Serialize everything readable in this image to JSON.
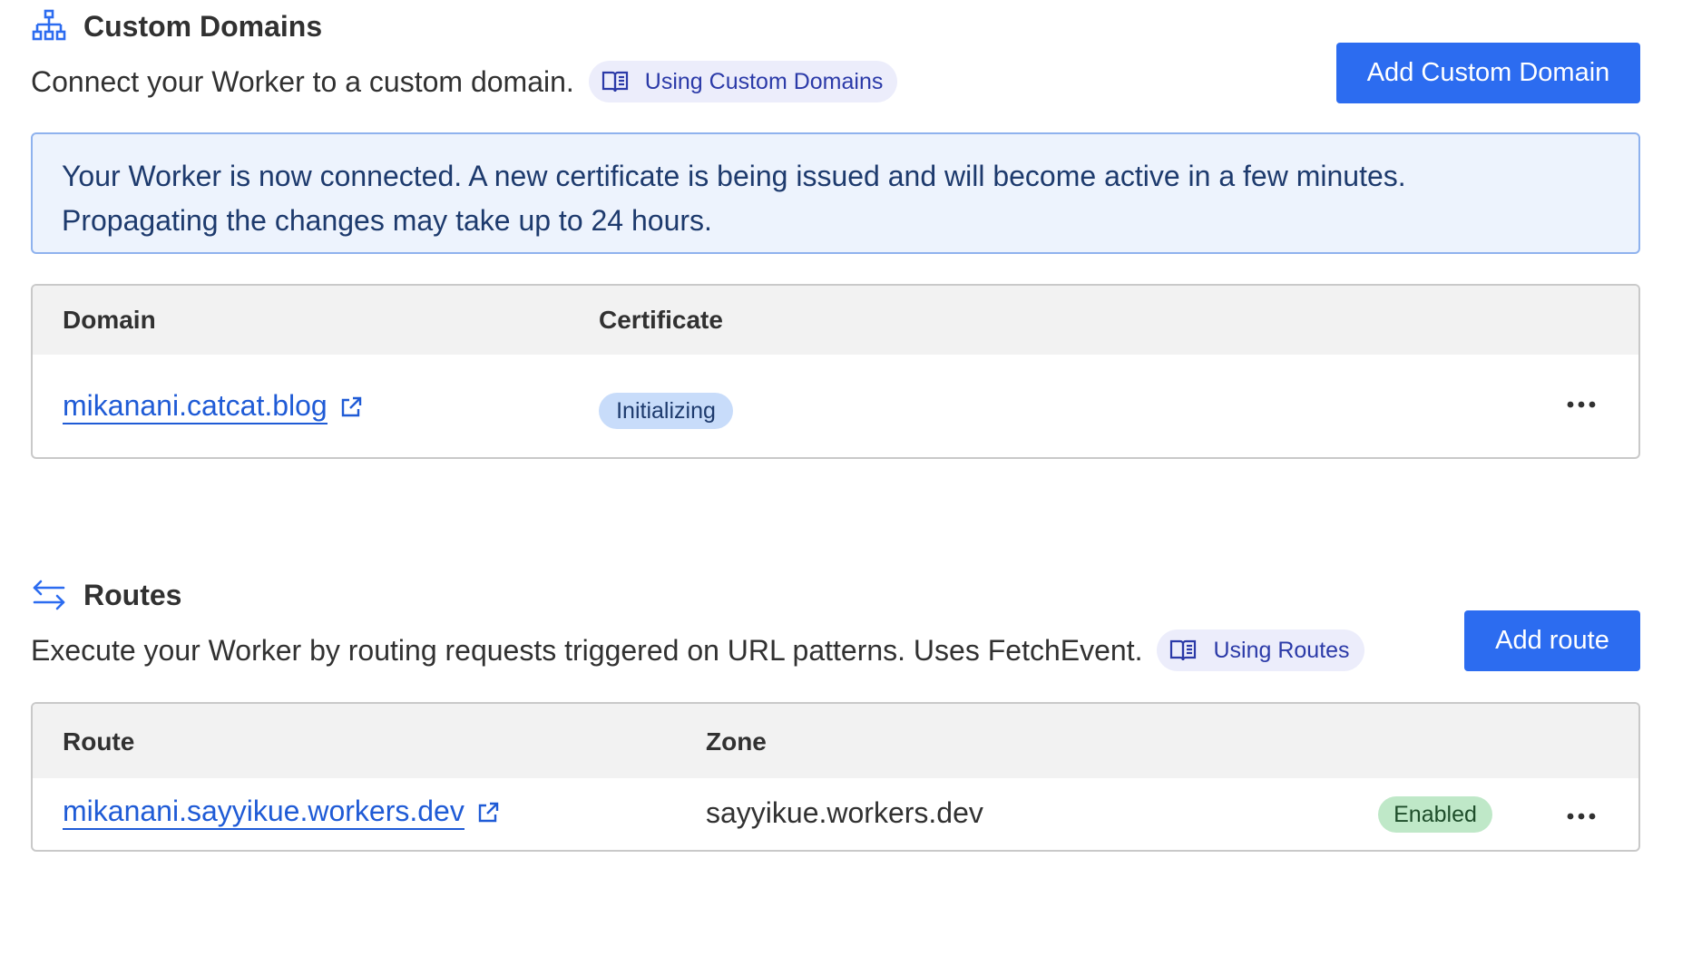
{
  "custom_domains": {
    "title": "Custom Domains",
    "icon": "sitemap-icon",
    "description": "Connect your Worker to a custom domain.",
    "docs_link": "Using Custom Domains",
    "add_button": "Add Custom Domain",
    "banner": {
      "line1": "Your Worker is now connected. A new certificate is being issued and will become active in a few minutes.",
      "line2": "Propagating the changes may take up to 24 hours."
    },
    "table": {
      "headers": [
        "Domain",
        "Certificate"
      ],
      "rows": [
        {
          "domain": "mikanani.catcat.blog",
          "certificate": "Initializing"
        }
      ]
    }
  },
  "routes": {
    "title": "Routes",
    "icon": "arrows-exchange-icon",
    "description": "Execute your Worker by routing requests triggered on URL patterns. Uses FetchEvent.",
    "docs_link": "Using Routes",
    "add_button": "Add route",
    "table": {
      "headers": [
        "Route",
        "Zone"
      ],
      "rows": [
        {
          "route": "mikanani.sayyikue.workers.dev",
          "zone": "sayyikue.workers.dev",
          "status": "Enabled"
        }
      ]
    }
  },
  "colors": {
    "primary": "#2c6cf0",
    "link": "#1f5bd6",
    "banner_bg": "#edf3fd",
    "banner_border": "#8fb2ee",
    "badge_initializing": "#c8dcfa",
    "badge_enabled": "#bfe8c8"
  }
}
